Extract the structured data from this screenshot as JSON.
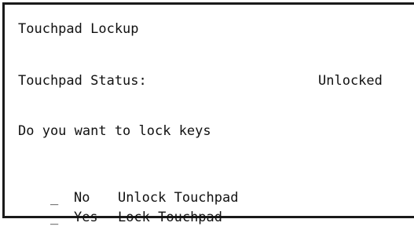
{
  "screen": {
    "title": "Touchpad Lockup",
    "status": {
      "label": "Touchpad Status:",
      "value": "Unlocked"
    },
    "question": "Do you want to lock keys",
    "options": [
      {
        "marker": "_",
        "key": "No",
        "description": "Unlock Touchpad"
      },
      {
        "marker": "_",
        "key": "Yes",
        "description": "Lock Touchpad"
      }
    ]
  }
}
